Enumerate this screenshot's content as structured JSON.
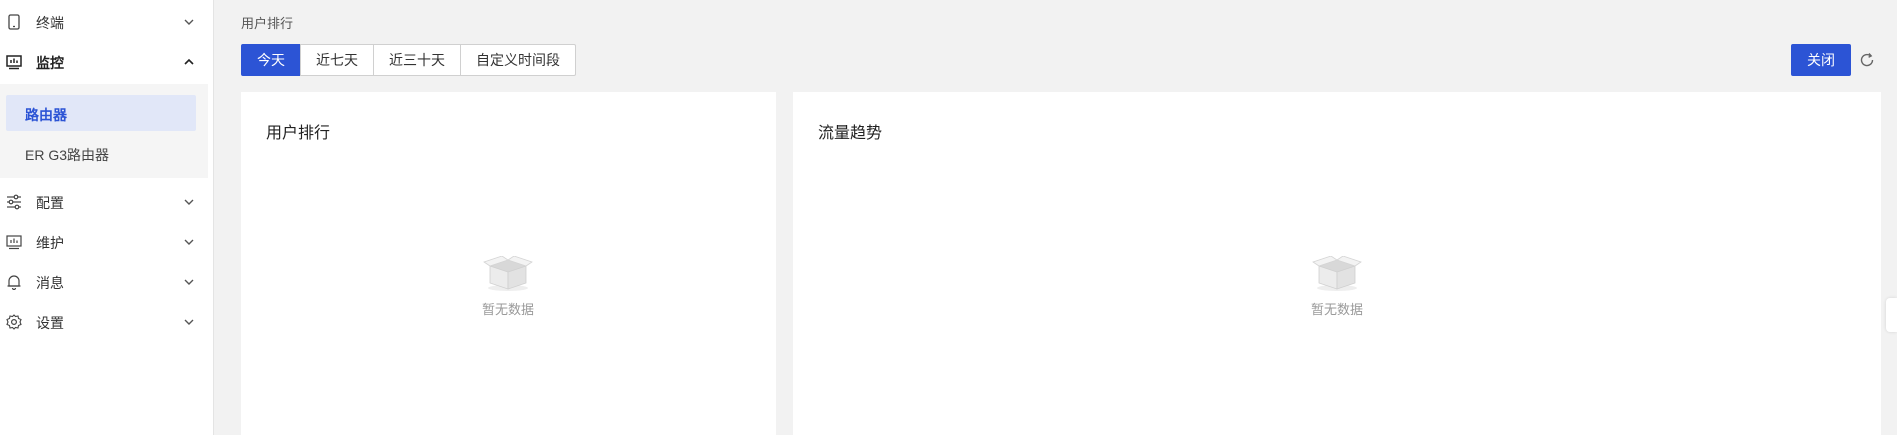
{
  "sidebar": {
    "items": [
      {
        "label": "终端",
        "icon": "tablet-icon",
        "expanded": false
      },
      {
        "label": "监控",
        "icon": "monitor-chart-icon",
        "expanded": true
      },
      {
        "label": "配置",
        "icon": "sliders-icon",
        "expanded": false
      },
      {
        "label": "维护",
        "icon": "maintenance-chart-icon",
        "expanded": false
      },
      {
        "label": "消息",
        "icon": "bell-icon",
        "expanded": false
      },
      {
        "label": "设置",
        "icon": "gear-icon",
        "expanded": false
      }
    ],
    "submenu": [
      {
        "label": "路由器",
        "active": true
      },
      {
        "label": "ER G3路由器",
        "active": false
      }
    ]
  },
  "breadcrumb": "用户排行",
  "range_tabs": [
    {
      "label": "今天",
      "active": true
    },
    {
      "label": "近七天",
      "active": false
    },
    {
      "label": "近三十天",
      "active": false
    },
    {
      "label": "自定义时间段",
      "active": false
    }
  ],
  "actions": {
    "close_label": "关闭",
    "refresh_icon": "refresh-icon"
  },
  "cards": [
    {
      "title": "用户排行",
      "empty_text": "暂无数据",
      "empty_icon": "empty-box-icon"
    },
    {
      "title": "流量趋势",
      "empty_text": "暂无数据",
      "empty_icon": "empty-box-icon"
    }
  ],
  "colors": {
    "accent": "#2c54d5",
    "active_bg": "#e1e7f8",
    "page_bg": "#f2f2f2"
  }
}
